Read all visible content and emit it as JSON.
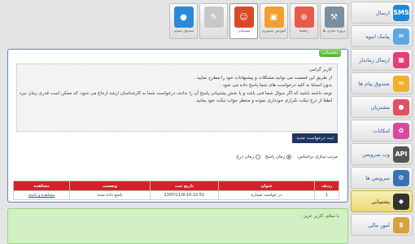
{
  "sidebar": {
    "items": [
      {
        "label": "ارسال",
        "icon": "sms-icon",
        "icon_text": "SMS",
        "color": "#1e88d8",
        "active": false
      },
      {
        "label": "پیامک انبوه",
        "icon": "bulk-sms-icon",
        "icon_text": "✉",
        "color": "#5aa9e6",
        "active": false
      },
      {
        "label": "ارسال زماندار",
        "icon": "calendar-icon",
        "icon_text": "▦",
        "color": "#e0407a",
        "active": false
      },
      {
        "label": "صندوق پیام ها",
        "icon": "inbox-icon",
        "icon_text": "✉",
        "color": "#f0b02a",
        "active": false
      },
      {
        "label": "مشتریان",
        "icon": "customers-icon",
        "icon_text": "●",
        "color": "#e05060",
        "active": false
      },
      {
        "label": "امکانات",
        "icon": "features-icon",
        "icon_text": "✿",
        "color": "#d84aa0",
        "active": false
      },
      {
        "label": "وب سرویس",
        "icon": "api-icon",
        "icon_text": "API",
        "color": "#555555",
        "active": false
      },
      {
        "label": "سرویس ها",
        "icon": "services-icon",
        "icon_text": "⚙",
        "color": "#3a6fb8",
        "active": false
      },
      {
        "label": "پشتیبانی",
        "icon": "graduation-cap-icon",
        "icon_text": "◆",
        "color": "#333333",
        "active": true
      },
      {
        "label": "امور مالی",
        "icon": "finance-icon",
        "icon_text": "$",
        "color": "#d8a040",
        "active": false
      }
    ]
  },
  "toolbar": {
    "items": [
      {
        "label": "پروژه سازی ها",
        "icon": "project-icon",
        "icon_text": "⚒",
        "color": "#7a8fa0",
        "active": false
      },
      {
        "label": "راهنما",
        "icon": "help-lifebuoy-icon",
        "icon_text": "⊕",
        "color": "#e85a4a",
        "active": false
      },
      {
        "label": "آموزش تصویری",
        "icon": "video-tutorial-icon",
        "icon_text": "▣",
        "color": "#f0a030",
        "active": false
      },
      {
        "label": "پشتیبانی",
        "icon": "support-person-icon",
        "icon_text": "☺",
        "color": "#d84a2a",
        "active": true
      },
      {
        "label": "",
        "icon": "support-center-sign-icon",
        "icon_text": "✎",
        "color": "#c8c8c8",
        "active": false
      },
      {
        "label": "صندوق صوتی",
        "icon": "microphone-icon",
        "icon_text": "●",
        "color": "#2a8ad8",
        "active": false
      }
    ]
  },
  "panel": {
    "tab_label": "پشتیبانی",
    "notice_lines": [
      "کاربر گرامی",
      "از طریق این قسمت می توانید مشکلات و پیشنهادات خود را مطرح نمایید .",
      "بدون استثنا به کلیه درخواست های شما پاسخ داده می شود .",
      "توجه داشته باشید که اگر سوال شما فنی باشد و یا بخش پشتیبانی پاسخ آن را ندانند، درخواست شما به کارشناسان ارشد ارجاع می شود، که ممکن است قدری زمان ببرد.",
      "لطفا از درج تیکت تکراری خودداری نموده و منتظر جواب تیکت خود بمانید ."
    ],
    "new_request_label": "ثبت درخواست جدید",
    "sort_label": "مرتب سازی براساس:",
    "sort_options": [
      {
        "label": "زمان پاسخ",
        "selected": true
      },
      {
        "label": "زمان درج",
        "selected": false
      }
    ],
    "table": {
      "headers": [
        "ردیف",
        "عنوان",
        "تاریخ ثبت",
        "وضعیت",
        "مشاهده"
      ],
      "rows": [
        [
          "1",
          "در خواست شماره",
          "1397/11/9-10:22:51",
          "پاسخ داده شده",
          "مشاهده و پاسخ"
        ]
      ]
    }
  },
  "bottom_panel": {
    "text": "با سلام، کاربر عزیز :"
  },
  "colors": {
    "panel_border": "#5a88c6",
    "table_header": "#d8202a",
    "new_request_button": "#1e3561",
    "active_sidebar": "#ecd873",
    "bottom_panel_bg": "#d3f0c4"
  }
}
